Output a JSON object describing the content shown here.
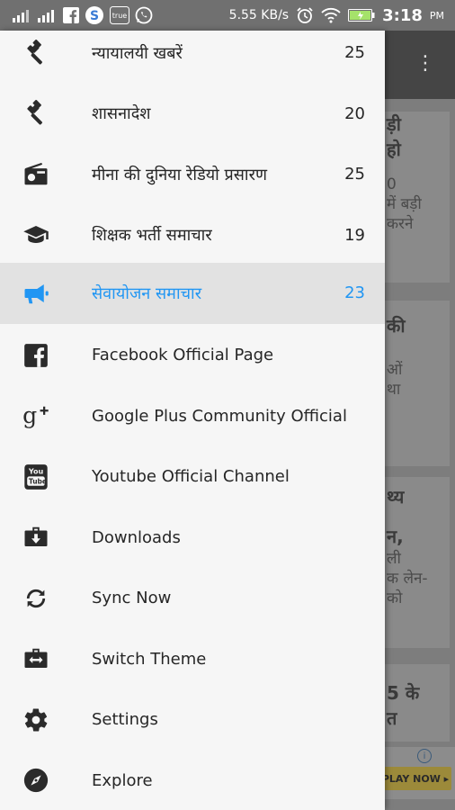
{
  "status_bar": {
    "network_speed": "5.55 KB/s",
    "time": "3:18",
    "ampm": "PM",
    "true_label": "true"
  },
  "background": {
    "cards": [
      {
        "lines": [
          "ड़ी",
          "हो",
          "",
          "0",
          "में बड़ी",
          "करने"
        ]
      },
      {
        "lines": [
          "की",
          "",
          "ओं",
          "था"
        ]
      },
      {
        "lines": [
          "थ्य",
          "",
          "न,",
          "ली",
          "क लेन-",
          "को"
        ]
      },
      {
        "lines": [
          "5 के",
          "त"
        ]
      }
    ],
    "ad_button": "PLAY NOW ▸",
    "ad_info": "i"
  },
  "drawer": {
    "items": [
      {
        "icon": "gavel-icon",
        "label": "न्यायालयी खबरें",
        "count": "25"
      },
      {
        "icon": "gavel-icon",
        "label": "शासनादेश",
        "count": "20"
      },
      {
        "icon": "radio-icon",
        "label": "मीना की दुनिया रेडियो प्रसारण",
        "count": "25"
      },
      {
        "icon": "graduation-cap-icon",
        "label": "शिक्षक भर्ती समाचार",
        "count": "19"
      },
      {
        "icon": "megaphone-icon",
        "label": "सेवायोजन समाचार",
        "count": "23",
        "selected": true
      },
      {
        "icon": "facebook-icon",
        "label": "Facebook Official Page",
        "count": ""
      },
      {
        "icon": "google-plus-icon",
        "label": "Google Plus Community Official",
        "count": ""
      },
      {
        "icon": "youtube-icon",
        "label": "Youtube Official Channel",
        "count": ""
      },
      {
        "icon": "downloads-icon",
        "label": "Downloads",
        "count": ""
      },
      {
        "icon": "sync-icon",
        "label": "Sync Now",
        "count": ""
      },
      {
        "icon": "switch-theme-icon",
        "label": "Switch Theme",
        "count": ""
      },
      {
        "icon": "settings-gear-icon",
        "label": "Settings",
        "count": ""
      },
      {
        "icon": "compass-icon",
        "label": "Explore",
        "count": ""
      }
    ]
  },
  "colors": {
    "selected": "#2196f3",
    "icon": "#2b2b2b",
    "drawer_bg": "#f6f6f6"
  }
}
